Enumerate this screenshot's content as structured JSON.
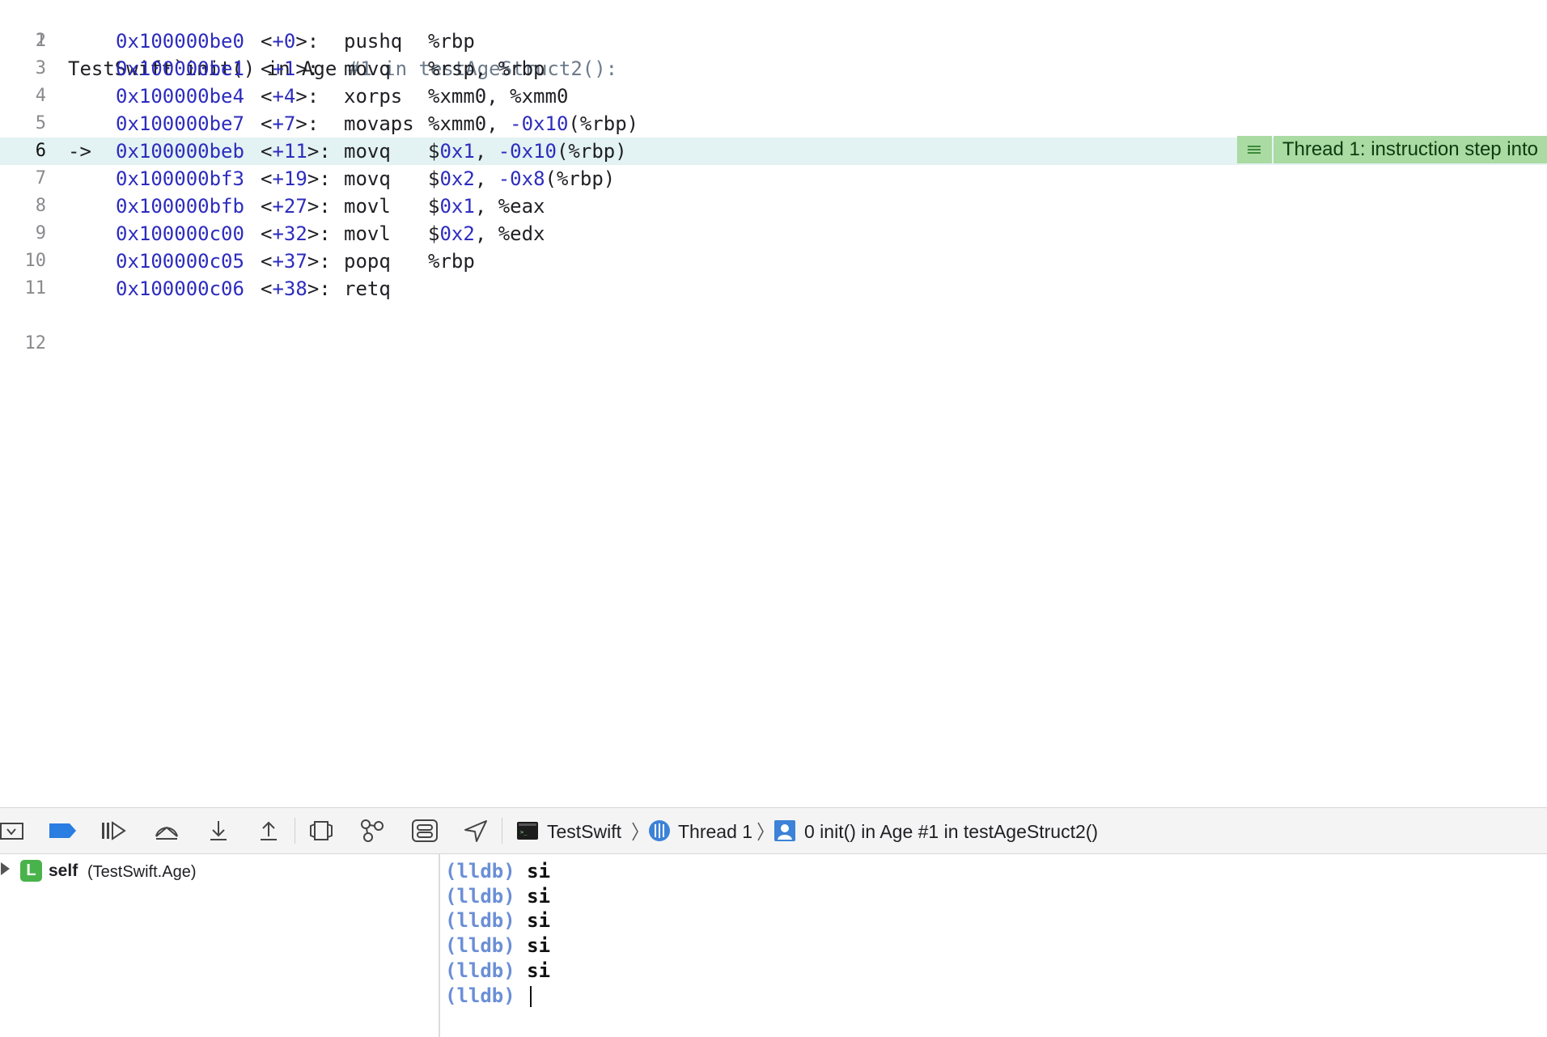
{
  "editor": {
    "header": {
      "number": "1",
      "prefix": "TestSwift`init() in Age ",
      "suffix": "#1 in testAgeStruct2():"
    },
    "lines": [
      {
        "number": "2",
        "address": "0x100000be0",
        "offset": "+0",
        "op": "pushq",
        "args": [
          {
            "t": "%rbp",
            "c": "plain"
          }
        ]
      },
      {
        "number": "3",
        "address": "0x100000be1",
        "offset": "+1",
        "op": "movq",
        "args": [
          {
            "t": "%rsp, %rbp",
            "c": "plain"
          }
        ]
      },
      {
        "number": "4",
        "address": "0x100000be4",
        "offset": "+4",
        "op": "xorps",
        "args": [
          {
            "t": "%xmm0, %xmm0",
            "c": "plain"
          }
        ]
      },
      {
        "number": "5",
        "address": "0x100000be7",
        "offset": "+7",
        "op": "movaps",
        "args": [
          {
            "t": "%xmm0, ",
            "c": "plain"
          },
          {
            "t": "-0x10",
            "c": "blue"
          },
          {
            "t": "(%rbp)",
            "c": "plain"
          }
        ]
      },
      {
        "number": "6",
        "address": "0x100000beb",
        "offset": "+11",
        "op": "movq",
        "current": true,
        "args": [
          {
            "t": "$",
            "c": "plain"
          },
          {
            "t": "0x1",
            "c": "blue"
          },
          {
            "t": ", ",
            "c": "plain"
          },
          {
            "t": "-0x10",
            "c": "blue"
          },
          {
            "t": "(%rbp)",
            "c": "plain"
          }
        ]
      },
      {
        "number": "7",
        "address": "0x100000bf3",
        "offset": "+19",
        "op": "movq",
        "args": [
          {
            "t": "$",
            "c": "plain"
          },
          {
            "t": "0x2",
            "c": "blue"
          },
          {
            "t": ", ",
            "c": "plain"
          },
          {
            "t": "-0x8",
            "c": "blue"
          },
          {
            "t": "(%rbp)",
            "c": "plain"
          }
        ]
      },
      {
        "number": "8",
        "address": "0x100000bfb",
        "offset": "+27",
        "op": "movl",
        "args": [
          {
            "t": "$",
            "c": "plain"
          },
          {
            "t": "0x1",
            "c": "blue"
          },
          {
            "t": ", %eax",
            "c": "plain"
          }
        ]
      },
      {
        "number": "9",
        "address": "0x100000c00",
        "offset": "+32",
        "op": "movl",
        "args": [
          {
            "t": "$",
            "c": "plain"
          },
          {
            "t": "0x2",
            "c": "blue"
          },
          {
            "t": ", %edx",
            "c": "plain"
          }
        ]
      },
      {
        "number": "10",
        "address": "0x100000c05",
        "offset": "+37",
        "op": "popq",
        "args": [
          {
            "t": "%rbp",
            "c": "plain"
          }
        ]
      },
      {
        "number": "11",
        "address": "0x100000c06",
        "offset": "+38",
        "op": "retq",
        "args": []
      }
    ],
    "last_line_number": "12",
    "current_arrow": "->",
    "annotation": "Thread 1: instruction step into"
  },
  "debug_bar": {
    "target": "TestSwift",
    "thread": "Thread 1",
    "frame": "0 init() in Age #1 in testAgeStruct2()"
  },
  "variables": {
    "badge": "L",
    "name": "self",
    "type": "(TestSwift.Age)"
  },
  "console": {
    "prompt": "(lldb)",
    "commands": [
      "si",
      "si",
      "si",
      "si",
      "si"
    ]
  },
  "colors": {
    "address_blue": "#2d2cbe",
    "current_line_bg": "#e3f2f2",
    "annotation_bg": "#a9dba2",
    "breakpoint_blue": "#2a7de1",
    "lldb_prompt": "#6b8fd6"
  }
}
